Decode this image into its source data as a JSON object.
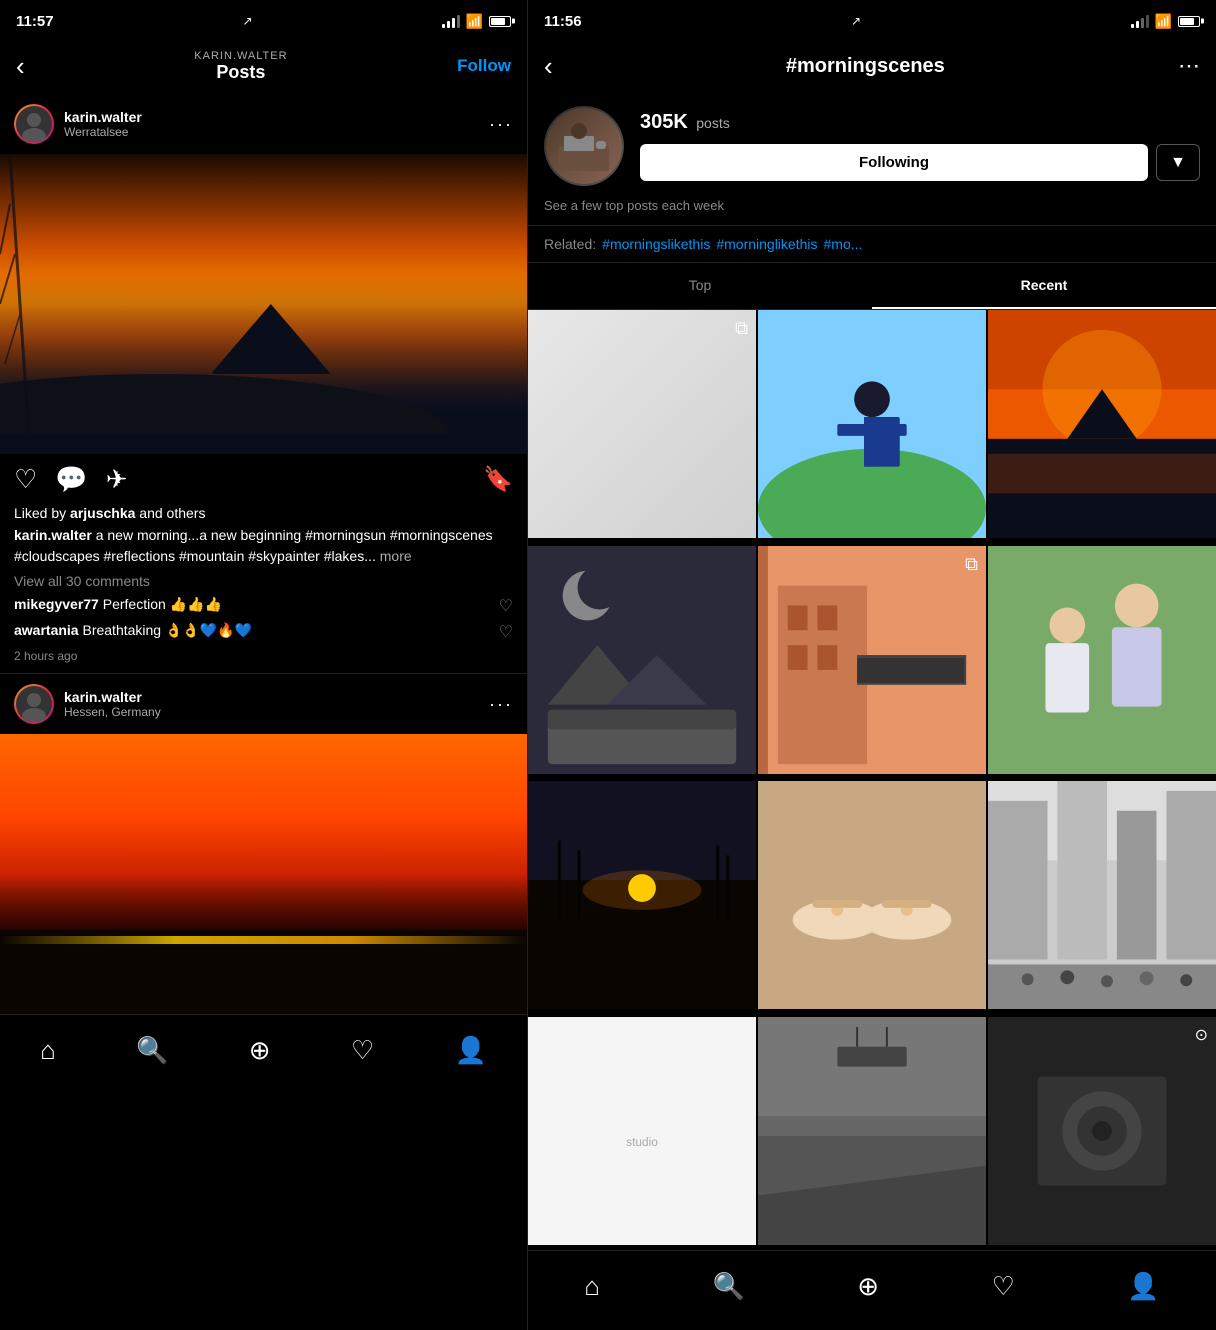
{
  "left": {
    "status_time": "11:57",
    "nav_username": "KARIN.WALTER",
    "nav_posts": "Posts",
    "nav_follow": "Follow",
    "post1": {
      "username": "karin.walter",
      "location": "Werratalsee",
      "likes_text": "Liked by ",
      "likes_bold": "arjuschka",
      "likes_suffix": " and others",
      "caption_user": "karin.walter",
      "caption_text": " a new morning...a new beginning #morningsun #morningscenes #cloudscapes #reflections #mountain #skypainter #lakes...",
      "more": "more",
      "view_comments": "View all 30 comments",
      "comment1_user": "mikegyver77",
      "comment1_text": " Perfection 👍👍👍",
      "comment2_user": "awartania",
      "comment2_text": " Breathtaking 👌👌💙🔥💙",
      "time": "2 hours ago"
    },
    "post2": {
      "username": "karin.walter",
      "location": "Hessen, Germany"
    }
  },
  "right": {
    "status_time": "11:56",
    "hashtag": "#morningscenes",
    "posts_count": "305K",
    "posts_label": "posts",
    "following_btn": "Following",
    "subtitle": "See a few top posts each week",
    "related_label": "Related:",
    "related_tags": [
      "#morningslikethis",
      "#morninglikethis",
      "#mo..."
    ],
    "tab_top": "Top",
    "tab_recent": "Recent",
    "grid": [
      {
        "type": "desk",
        "multi": true
      },
      {
        "type": "person-blue",
        "multi": false
      },
      {
        "type": "sunset-water",
        "multi": false
      },
      {
        "type": "bedroom",
        "multi": false
      },
      {
        "type": "building",
        "multi": true
      },
      {
        "type": "mother-child",
        "multi": false
      },
      {
        "type": "sunrise-field",
        "multi": false
      },
      {
        "type": "sandals",
        "multi": false
      },
      {
        "type": "city-street",
        "multi": false
      },
      {
        "type": "white",
        "multi": false
      },
      {
        "type": "street2",
        "multi": false
      },
      {
        "type": "closeup",
        "camera": true
      }
    ]
  },
  "bottomnav": {
    "items": [
      "home",
      "search",
      "add",
      "heart",
      "profile"
    ]
  }
}
